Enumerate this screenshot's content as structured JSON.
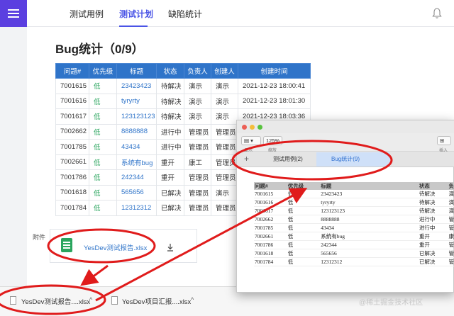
{
  "nav": {
    "tabs": [
      {
        "label": "测试用例",
        "active": false
      },
      {
        "label": "测试计划",
        "active": true
      },
      {
        "label": "缺陷统计",
        "active": false
      }
    ],
    "accent": "#4a54e6"
  },
  "page": {
    "title": "Bug统计（0/9）"
  },
  "bug_table": {
    "headers": [
      "问题#",
      "优先级",
      "标题",
      "状态",
      "负责人",
      "创建人",
      "创建时间"
    ],
    "rows": [
      [
        "7001615",
        "低",
        "23423423",
        "待解决",
        "演示",
        "演示",
        "2021-12-23 18:00:41"
      ],
      [
        "7001616",
        "低",
        "tyryrty",
        "待解决",
        "演示",
        "演示",
        "2021-12-23 18:01:30"
      ],
      [
        "7001617",
        "低",
        "123123123",
        "待解决",
        "演示",
        "演示",
        "2021-12-23 18:03:36"
      ],
      [
        "7002662",
        "低",
        "8888888",
        "进行中",
        "管理员",
        "管理员",
        ""
      ],
      [
        "7001785",
        "低",
        "43434",
        "进行中",
        "管理员",
        "管理员",
        ""
      ],
      [
        "7002661",
        "低",
        "系统有bug",
        "重开",
        "康工",
        "管理员",
        ""
      ],
      [
        "7001786",
        "低",
        "242344",
        "重开",
        "管理员",
        "管理员",
        ""
      ],
      [
        "7001618",
        "低",
        "565656",
        "已解决",
        "管理员",
        "演示",
        ""
      ],
      [
        "7001784",
        "低",
        "12312312",
        "已解决",
        "管理员",
        "管理员",
        ""
      ]
    ]
  },
  "attachment": {
    "label": "附件",
    "file_name": "YesDev测试报告.xlsx",
    "icon": "excel-file-icon"
  },
  "downloads": [
    {
      "name": "YesDev测试报告....xlsx"
    },
    {
      "name": "YesDev项目汇报....xlsx"
    }
  ],
  "excel": {
    "zoom": "125%",
    "toolbar_labels": [
      "显示",
      "缩放",
      "插入"
    ],
    "sheet_tabs": [
      {
        "label": "测试用例(2)",
        "active": false
      },
      {
        "label": "Bug统计(9)",
        "active": true
      }
    ],
    "headers": [
      "问题#",
      "优先级",
      "标题",
      "状态",
      "负"
    ],
    "rows": [
      [
        "7001615",
        "低",
        "23423423",
        "待解决",
        "演"
      ],
      [
        "7001616",
        "低",
        "tyryrty",
        "待解决",
        "演"
      ],
      [
        "7001617",
        "低",
        "123123123",
        "待解决",
        "演"
      ],
      [
        "7002662",
        "低",
        "8888888",
        "进行中",
        "管"
      ],
      [
        "7001785",
        "低",
        "43434",
        "进行中",
        "管"
      ],
      [
        "7002661",
        "低",
        "系统有bug",
        "重开",
        "康"
      ],
      [
        "7001786",
        "低",
        "242344",
        "重开",
        "管"
      ],
      [
        "7001618",
        "低",
        "565656",
        "已解决",
        "管"
      ],
      [
        "7001784",
        "低",
        "12312312",
        "已解决",
        "管"
      ]
    ]
  },
  "watermark": "@稀土掘金技术社区",
  "colors": {
    "annotation": "#e01b1b",
    "header_blue": "#2f74c9",
    "priority_green": "#2aa55e"
  }
}
